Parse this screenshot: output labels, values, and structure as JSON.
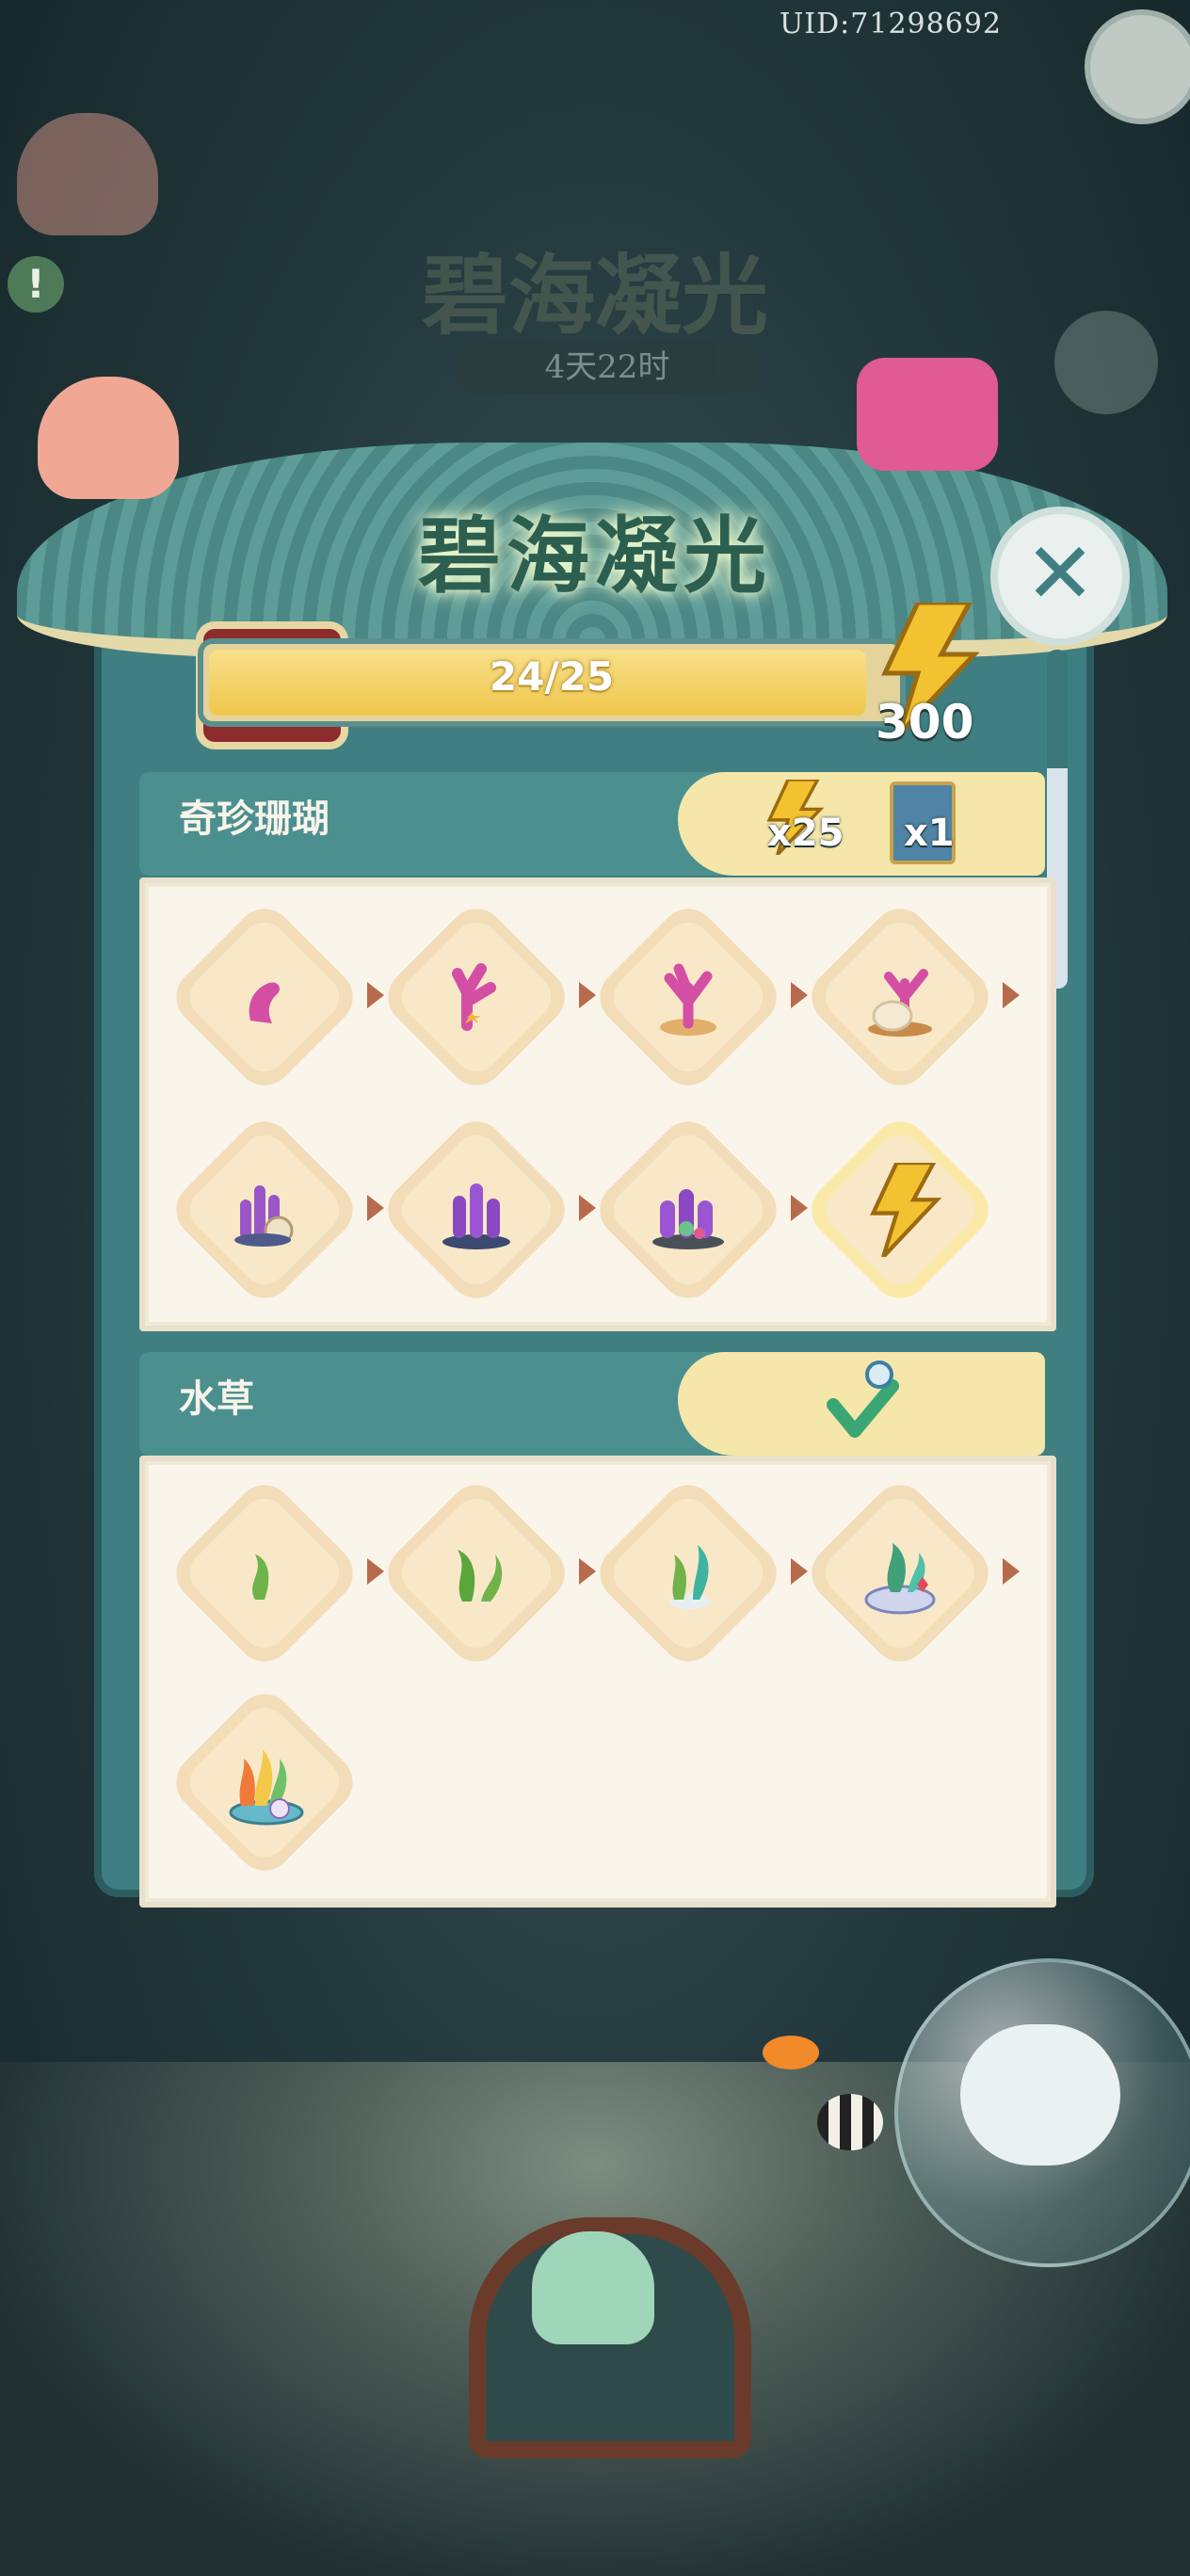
{
  "header": {
    "uid": "UID:71298692",
    "dim_title": "碧海凝光",
    "dim_timer": "4天22时"
  },
  "panel": {
    "title": "碧海凝光",
    "close_label": "✕",
    "progress": {
      "text": "24/25",
      "fraction": 0.96
    },
    "energy_count": "300"
  },
  "sections": [
    {
      "label": "奇珍珊瑚",
      "rewards": [
        "x25",
        "x1"
      ],
      "items": [
        "coral-1",
        "coral-2",
        "coral-3",
        "coral-4",
        "coral-5",
        "coral-6",
        "coral-7",
        "energy-bolt"
      ]
    },
    {
      "label": "水草",
      "items": [
        "seaweed-1",
        "seaweed-2",
        "seaweed-3",
        "seaweed-4",
        "seaweed-5"
      ]
    }
  ],
  "colors": {
    "panel": "#3f7f82",
    "header_bar": "#4c8f8f",
    "reward_tab": "#f5e6a9",
    "card": "#faf5ea",
    "tile": "#f2ddb8",
    "bolt": "#f2c230",
    "arrow": "#b86a4c"
  },
  "icons": {
    "alert": "!",
    "close": "✕"
  }
}
